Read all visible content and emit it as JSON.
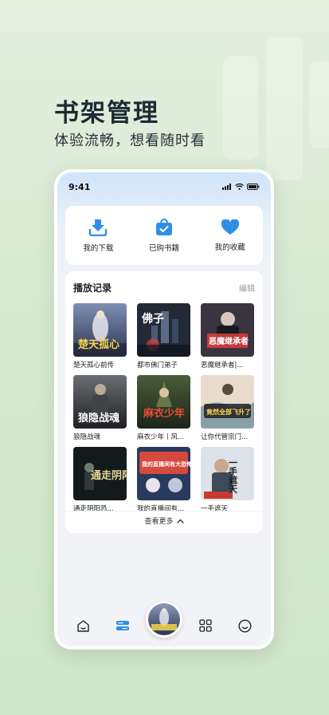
{
  "headline": "书架管理",
  "subline": "体验流畅，想看随时看",
  "status": {
    "time": "9:41"
  },
  "quick_actions": [
    {
      "label": "我的下载",
      "icon": "download-icon"
    },
    {
      "label": "已购书籍",
      "icon": "purchased-bag-icon"
    },
    {
      "label": "我的收藏",
      "icon": "heart-icon"
    }
  ],
  "history": {
    "title": "播放记录",
    "edit_label": "编辑",
    "more_label": "查看更多",
    "books": [
      {
        "title": "楚天孤心前传",
        "cover_text": "楚天孤心"
      },
      {
        "title": "都市佛门弟子",
        "cover_text": "佛子"
      },
      {
        "title": "恶魔继承者|...",
        "cover_text": "恶魔继承者"
      },
      {
        "title": "狼隐战魂",
        "cover_text": "狼隐战魂"
      },
      {
        "title": "麻衣少年丨风...",
        "cover_text": "麻衣少年"
      },
      {
        "title": "让你代管宗门...",
        "cover_text": "竟然全部飞升了"
      },
      {
        "title": "通走阴阳恐...",
        "cover_text": "通走阴阳"
      },
      {
        "title": "我的直播间有...",
        "cover_text": "我的直播间有大恐怖"
      },
      {
        "title": "一手遮天",
        "cover_text": "一手遮天"
      }
    ]
  },
  "colors": {
    "accent": "#2f8fe8",
    "headline": "#1b2b33",
    "bg": "#dcebd6"
  },
  "tabbar": [
    "home-icon",
    "bookshelf-icon",
    "player-cover",
    "category-grid-icon",
    "profile-smile-icon"
  ]
}
